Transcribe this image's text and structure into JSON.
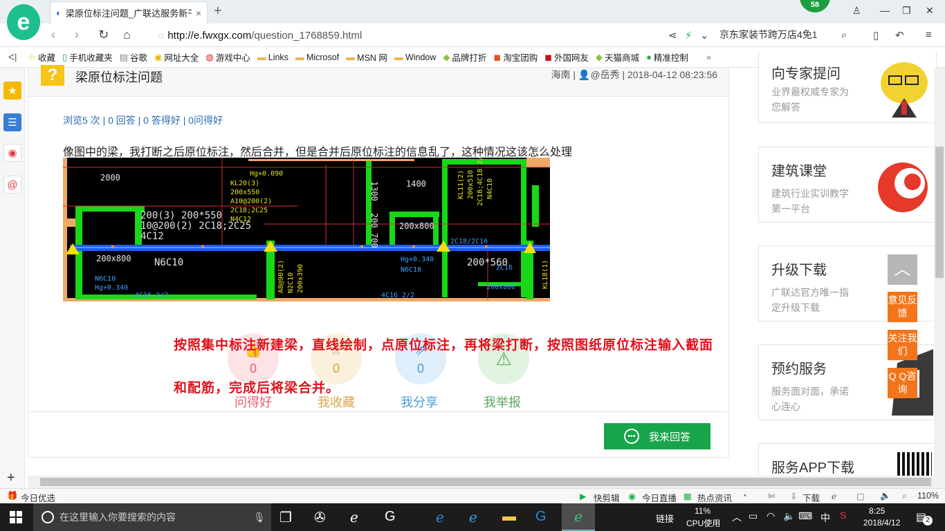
{
  "browser": {
    "tab_title": "梁原位标注问题_广联达服务新干",
    "tab_close": "×",
    "new_tab": "+",
    "notif_count": "58",
    "url_host": "http://e.fwxgx.com",
    "url_path": "/question_1768859.html",
    "search_text": "京东家装节跨万店4免1",
    "favorites": [
      {
        "icon": "☆",
        "label": "收藏"
      },
      {
        "icon": "▯",
        "label": "手机收藏夹"
      },
      {
        "icon": "▤",
        "label": "谷歌"
      },
      {
        "icon": "◉",
        "label": "网址大全"
      },
      {
        "icon": "◍",
        "label": "游戏中心"
      },
      {
        "icon": "▬",
        "label": "Links"
      },
      {
        "icon": "▬",
        "label": "Microsof"
      },
      {
        "icon": "▬",
        "label": "MSN 网"
      },
      {
        "icon": "▬",
        "label": "Window"
      },
      {
        "icon": "◆",
        "label": "品牌打折"
      },
      {
        "icon": "◼",
        "label": "淘宝团购"
      },
      {
        "icon": "◼",
        "label": "外国网友"
      },
      {
        "icon": "◆",
        "label": "天猫商城"
      },
      {
        "icon": "●",
        "label": "精准控制"
      }
    ]
  },
  "question": {
    "title": "梁原位标注问题",
    "location": "海南",
    "author": "@岳秀",
    "datetime": "2018-04-12 08:23:56",
    "stats": "浏览5 次 | 0 回答 | 0 答得好 | 0问得好",
    "body": "像图中的梁，我打断之后原位标注，然后合并，但是合并后原位标注的信息乱了，这种情况这该怎么处理"
  },
  "answer_text": "按照集中标注新建梁，直线绘制，点原位标注，再将梁打断，按照图纸原位标注输入截面和配筋，完成后将梁合并。",
  "actions": [
    {
      "label": "问得好",
      "count": "0",
      "color": "#e06070",
      "bg": "#fbe3e6"
    },
    {
      "label": "我收藏",
      "count": "0",
      "color": "#d9a441",
      "bg": "#fbf0dc"
    },
    {
      "label": "我分享",
      "count": "0",
      "color": "#4a9ed8",
      "bg": "#dfeefb"
    },
    {
      "label": "我举报",
      "count": "",
      "color": "#59a85e",
      "bg": "#e0f3e1"
    }
  ],
  "answer_button": "我来回答",
  "cards": [
    {
      "title": "向专家提问",
      "desc": "业界最权威专家为您解答"
    },
    {
      "title": "建筑课堂",
      "desc": "建筑行业实训教学第一平台"
    },
    {
      "title": "升级下载",
      "desc": "广联达官方唯一指定升级下载"
    },
    {
      "title": "预约服务",
      "desc": "服务面对面，承诺心连心"
    },
    {
      "title": "服务APP下载",
      "desc": ""
    }
  ],
  "floats": [
    "意见反馈",
    "关注我们",
    "Q Q咨询"
  ],
  "cad": {
    "t1": "2000",
    "t2": "Hg+0.090",
    "t3": "KL20(3)",
    "t4": "200x550",
    "t5": "A10@200(2)",
    "t6": "2C18;2C25",
    "t7": "N4C12",
    "t8": "1400",
    "t9": "1300",
    "t10": "200 700",
    "t11": "200x800",
    "t12": "KL11(2)",
    "t13": "200x510",
    "t14": "2C18;4C18 2/2",
    "t15": "N4C10",
    "t16": "200x800",
    "t17": "N6C10",
    "t18": "Hg+0.340",
    "t19": "N6C10",
    "t20": "2C16",
    "t21": "200*560",
    "t22": "200(3) 200*550",
    "t23": "10@200(2) 2C18;2C25",
    "t24": "4C12",
    "t25": "4C16 2/2",
    "t26": "A8@90(2)",
    "t27": "N2C10",
    "t28": "200x390",
    "t29": "2C18/2C16",
    "t30": "KL18(1)"
  },
  "statusbar": {
    "left": "今日优选",
    "items": [
      "快剪辑",
      "今日直播",
      "热点资讯",
      "下载"
    ],
    "zoom": "110%"
  },
  "taskbar": {
    "search_placeholder": "在这里输入你要搜索的内容",
    "link_label": "链接",
    "cpu_percent": "11%",
    "cpu_label": "CPU使用",
    "ime": "中",
    "time": "8:25",
    "date": "2018/4/12",
    "notif": "2"
  }
}
